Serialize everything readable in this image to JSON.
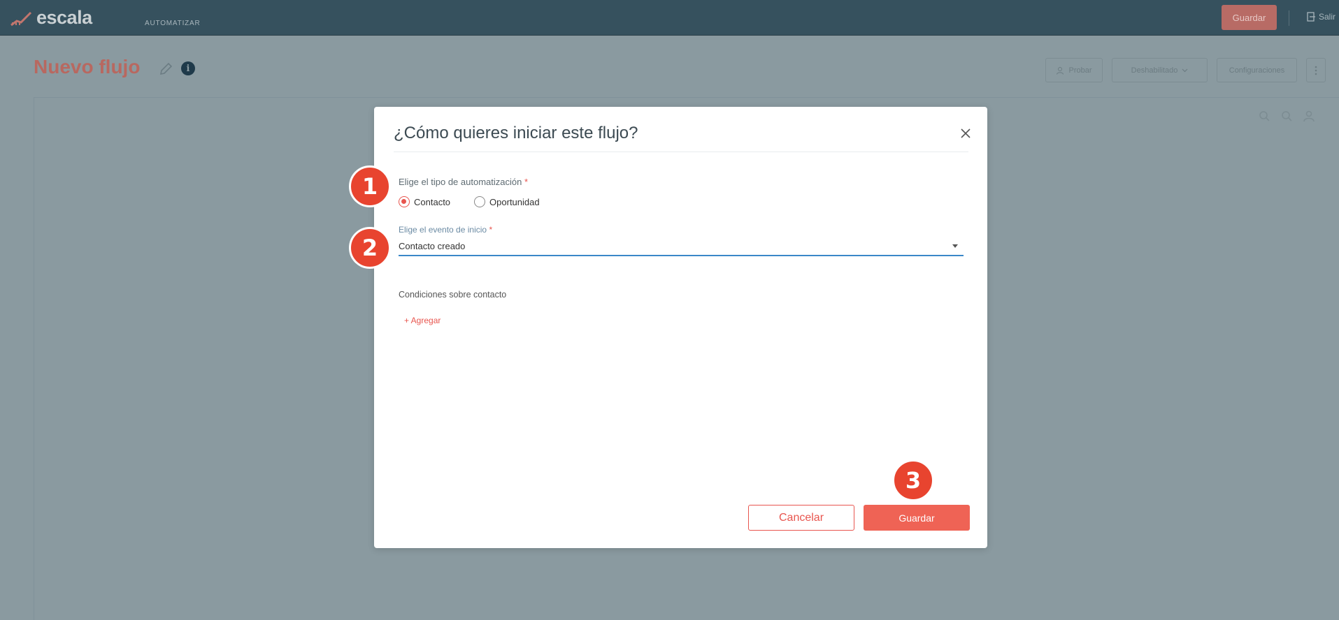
{
  "topbar": {
    "logo_text": "escala",
    "nav_item": "AUTOMATIZAR",
    "save_label": "Guardar",
    "exit_label": "Salir"
  },
  "header": {
    "title": "Nuevo flujo",
    "test_label": "Probar",
    "status_label": "Deshabilitado",
    "config_label": "Configuraciones"
  },
  "modal": {
    "title": "¿Cómo quieres iniciar este flujo?",
    "type_label": "Elige el tipo de automatización",
    "type_options": [
      "Contacto",
      "Oportunidad"
    ],
    "type_selected": "Contacto",
    "event_label": "Elige el evento de inicio",
    "event_value": "Contacto creado",
    "conditions_label": "Condiciones sobre contacto",
    "add_label": "+ Agregar",
    "cancel_label": "Cancelar",
    "save_label": "Guardar",
    "required_mark": "*"
  },
  "steps": [
    "1",
    "2",
    "3"
  ],
  "colors": {
    "accent": "#ef6355",
    "topbar": "#36515e",
    "focus": "#3a87c8",
    "step": "#e8442f"
  }
}
